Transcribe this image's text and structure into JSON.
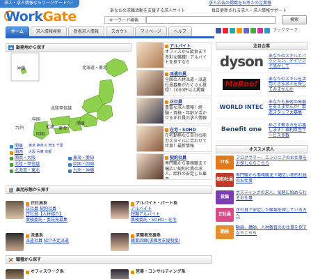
{
  "header": {
    "top_tag": "求人・求人情報ならワークゲートへ！",
    "logo_work": "Work",
    "logo_gate": "Gate",
    "ad_link": "求人広告の掲載をお考えの企業様",
    "tagline": "あなたの求職活動を支援する求人サイト 毎日更新される求人・求人情報",
    "tagline2": "あなたの求職活動を支援する求人サイト",
    "keyword_label": "キーワード検索",
    "keyword_placeholder": "",
    "search_button": "検索"
  },
  "nav": {
    "tabs": [
      "ホーム",
      "求人情報検索",
      "新着求人情報",
      "スカウト",
      "マイページ",
      "ヘルプ"
    ],
    "active": 0,
    "bookmark_label": "ブックマーク"
  },
  "sections": {
    "area": "勤務地から探す",
    "employment": "雇用形態から探す",
    "occupation": "職種から探す"
  },
  "map": {
    "regions": [
      "沖縄",
      "北海道・東北",
      "北陸甲信越",
      "関東",
      "東海",
      "近畿",
      "中国",
      "四国",
      "九州"
    ]
  },
  "region_links": [
    [
      "関東",
      "東京",
      "神奈川",
      "埼玉",
      "千葉"
    ],
    [
      "関西",
      "大阪",
      "兵庫",
      "京都"
    ],
    [
      "北海道・東北",
      "中国・四国"
    ],
    [
      "北陸・甲信越",
      "九州・沖縄"
    ]
  ],
  "region_links_rows": [
    {
      "a": "関東",
      "b": "東京 神奈川 埼玉 千葉"
    },
    {
      "a": "関西",
      "b": "大阪 兵庫 京都"
    },
    {
      "a": "東海",
      "b": "愛知 静岡"
    }
  ],
  "region_pairs": [
    [
      "関西・大阪",
      "東海・愛知"
    ],
    [
      "北陸・甲信越",
      "中国・四国"
    ],
    [
      "北海道・東北",
      "九州・沖縄"
    ]
  ],
  "employment_cats": [
    {
      "title": "正社員系",
      "links": [
        "正社員",
        "契約社員",
        "正社員【人材紹介】",
        "業務委託・委託先募集"
      ]
    },
    {
      "title": "アルバイト・パート系",
      "links": [
        "アルバイト",
        "短期アルバイト",
        "業務委託・SOHO・在宅"
      ]
    },
    {
      "title": "派遣系",
      "links": [
        "派遣社員",
        "紹介予定派遣"
      ]
    },
    {
      "title": "求職者支援系",
      "links": [
        "職業訓練(求職者支援制度)"
      ]
    }
  ],
  "occupation_cats": [
    {
      "title": "オフィスワーク系"
    },
    {
      "title": "営業・コンサルティング系"
    }
  ],
  "features": [
    {
      "title": "アルバイト",
      "text": "オフィスから飲食まで多彩な職種！アルバイトを探すなら"
    },
    {
      "title": "派遣社員",
      "text": "全国の人材派遣・派遣社員募集がたくさん登録！1000件以上掲載"
    },
    {
      "title": "正社員",
      "text": "豊富な求人情報！経験・資格・年齢が活かせる正社員の求人情報"
    },
    {
      "title": "在宅・SOHO",
      "text": "在宅勤務なら自分の能力スタイルに合わせて仕事！最新情報"
    },
    {
      "title": "契約社員",
      "text": "専門職から事務職まで幅広い契約社員の求人。給料の安定した雇用"
    }
  ],
  "companies_title": "注目企業",
  "companies": [
    {
      "name": "dyson",
      "text": "あなたのスキルとパッション、ダイソンで活かして"
    },
    {
      "name": "MaBoo!",
      "text": "あなたのスキルを活用できる求人を探してみませんか"
    },
    {
      "name": "WORLD INTEC",
      "text": "あなたも技術の発展を支えませんか！製造スタッフ大募集"
    },
    {
      "name": "Benefit one",
      "text": "めざす働き方を応援します！福利厚生サービス多数"
    }
  ],
  "recommend_title": "オススメ求人",
  "recommend": [
    {
      "tag": "IT系",
      "text": "プログラマー、エンジニアのお仕事をお探しならこちら",
      "color": "#e07a1a"
    },
    {
      "tag": "契約社員",
      "text": "専門職から事務職まで幅広い契約社員のお仕事",
      "color": "#c0392b"
    },
    {
      "tag": "投稿",
      "text": "ポスティングの求人、気軽に始められるお仕事",
      "color": "#7b3fb0"
    },
    {
      "tag": "正社員",
      "text": "正社員で安定した職場を探している方へ",
      "color": "#d64b8a"
    },
    {
      "tag": "勤務",
      "text": "動画、講師、人材教育のお仕事を探すならこちら",
      "color": "#e88f2c"
    }
  ],
  "colors": {
    "brand_blue": "#2b6cc8",
    "brand_orange": "#f08a00",
    "map_green": "#8fd14f"
  }
}
